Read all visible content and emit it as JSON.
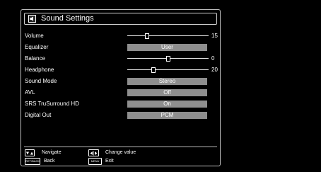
{
  "menu": {
    "title": "Sound Settings",
    "title_icon": "speaker-settings-icon",
    "items": [
      {
        "label": "Volume",
        "kind": "slider",
        "value": "15",
        "level": 0.24
      },
      {
        "label": "Equalizer",
        "kind": "option",
        "value": "User"
      },
      {
        "label": "Balance",
        "kind": "slider",
        "value": "0",
        "level": 0.5
      },
      {
        "label": "Headphone",
        "kind": "slider",
        "value": "20",
        "level": 0.32
      },
      {
        "label": "Sound Mode",
        "kind": "option",
        "value": "Stereo"
      },
      {
        "label": "AVL",
        "kind": "option",
        "value": "Off"
      },
      {
        "label": "SRS TruSurround HD",
        "kind": "option",
        "value": "On"
      },
      {
        "label": "Digital Out",
        "kind": "option",
        "value": "PCM"
      }
    ]
  },
  "footer": {
    "navigate": {
      "icon": "up-down-arrows-icon",
      "label": "Navigate"
    },
    "change_value": {
      "icon": "left-right-arrows-icon",
      "label": "Change value"
    },
    "back": {
      "key": "RET/BACK",
      "label": "Back"
    },
    "exit": {
      "key": "MENU",
      "label": "Exit"
    }
  },
  "colors": {
    "background": "#000000",
    "option_fill": "#8e8e8e",
    "border": "#bdbdbd"
  }
}
